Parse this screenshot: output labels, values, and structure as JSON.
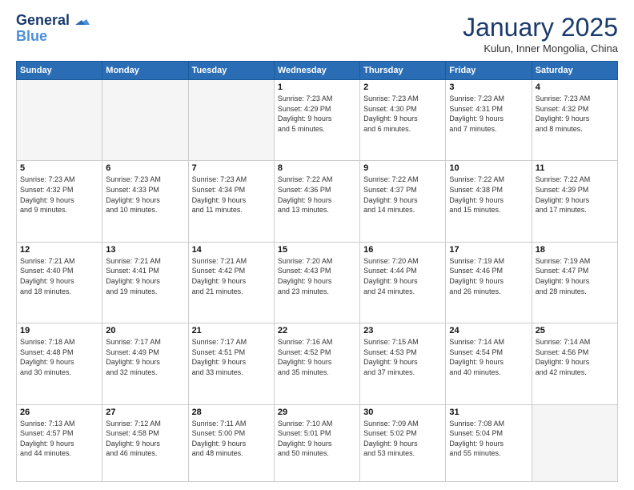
{
  "header": {
    "logo_line1": "General",
    "logo_line2": "Blue",
    "month": "January 2025",
    "location": "Kulun, Inner Mongolia, China"
  },
  "weekdays": [
    "Sunday",
    "Monday",
    "Tuesday",
    "Wednesday",
    "Thursday",
    "Friday",
    "Saturday"
  ],
  "weeks": [
    [
      {
        "day": "",
        "detail": ""
      },
      {
        "day": "",
        "detail": ""
      },
      {
        "day": "",
        "detail": ""
      },
      {
        "day": "1",
        "detail": "Sunrise: 7:23 AM\nSunset: 4:29 PM\nDaylight: 9 hours\nand 5 minutes."
      },
      {
        "day": "2",
        "detail": "Sunrise: 7:23 AM\nSunset: 4:30 PM\nDaylight: 9 hours\nand 6 minutes."
      },
      {
        "day": "3",
        "detail": "Sunrise: 7:23 AM\nSunset: 4:31 PM\nDaylight: 9 hours\nand 7 minutes."
      },
      {
        "day": "4",
        "detail": "Sunrise: 7:23 AM\nSunset: 4:32 PM\nDaylight: 9 hours\nand 8 minutes."
      }
    ],
    [
      {
        "day": "5",
        "detail": "Sunrise: 7:23 AM\nSunset: 4:32 PM\nDaylight: 9 hours\nand 9 minutes."
      },
      {
        "day": "6",
        "detail": "Sunrise: 7:23 AM\nSunset: 4:33 PM\nDaylight: 9 hours\nand 10 minutes."
      },
      {
        "day": "7",
        "detail": "Sunrise: 7:23 AM\nSunset: 4:34 PM\nDaylight: 9 hours\nand 11 minutes."
      },
      {
        "day": "8",
        "detail": "Sunrise: 7:22 AM\nSunset: 4:36 PM\nDaylight: 9 hours\nand 13 minutes."
      },
      {
        "day": "9",
        "detail": "Sunrise: 7:22 AM\nSunset: 4:37 PM\nDaylight: 9 hours\nand 14 minutes."
      },
      {
        "day": "10",
        "detail": "Sunrise: 7:22 AM\nSunset: 4:38 PM\nDaylight: 9 hours\nand 15 minutes."
      },
      {
        "day": "11",
        "detail": "Sunrise: 7:22 AM\nSunset: 4:39 PM\nDaylight: 9 hours\nand 17 minutes."
      }
    ],
    [
      {
        "day": "12",
        "detail": "Sunrise: 7:21 AM\nSunset: 4:40 PM\nDaylight: 9 hours\nand 18 minutes."
      },
      {
        "day": "13",
        "detail": "Sunrise: 7:21 AM\nSunset: 4:41 PM\nDaylight: 9 hours\nand 19 minutes."
      },
      {
        "day": "14",
        "detail": "Sunrise: 7:21 AM\nSunset: 4:42 PM\nDaylight: 9 hours\nand 21 minutes."
      },
      {
        "day": "15",
        "detail": "Sunrise: 7:20 AM\nSunset: 4:43 PM\nDaylight: 9 hours\nand 23 minutes."
      },
      {
        "day": "16",
        "detail": "Sunrise: 7:20 AM\nSunset: 4:44 PM\nDaylight: 9 hours\nand 24 minutes."
      },
      {
        "day": "17",
        "detail": "Sunrise: 7:19 AM\nSunset: 4:46 PM\nDaylight: 9 hours\nand 26 minutes."
      },
      {
        "day": "18",
        "detail": "Sunrise: 7:19 AM\nSunset: 4:47 PM\nDaylight: 9 hours\nand 28 minutes."
      }
    ],
    [
      {
        "day": "19",
        "detail": "Sunrise: 7:18 AM\nSunset: 4:48 PM\nDaylight: 9 hours\nand 30 minutes."
      },
      {
        "day": "20",
        "detail": "Sunrise: 7:17 AM\nSunset: 4:49 PM\nDaylight: 9 hours\nand 32 minutes."
      },
      {
        "day": "21",
        "detail": "Sunrise: 7:17 AM\nSunset: 4:51 PM\nDaylight: 9 hours\nand 33 minutes."
      },
      {
        "day": "22",
        "detail": "Sunrise: 7:16 AM\nSunset: 4:52 PM\nDaylight: 9 hours\nand 35 minutes."
      },
      {
        "day": "23",
        "detail": "Sunrise: 7:15 AM\nSunset: 4:53 PM\nDaylight: 9 hours\nand 37 minutes."
      },
      {
        "day": "24",
        "detail": "Sunrise: 7:14 AM\nSunset: 4:54 PM\nDaylight: 9 hours\nand 40 minutes."
      },
      {
        "day": "25",
        "detail": "Sunrise: 7:14 AM\nSunset: 4:56 PM\nDaylight: 9 hours\nand 42 minutes."
      }
    ],
    [
      {
        "day": "26",
        "detail": "Sunrise: 7:13 AM\nSunset: 4:57 PM\nDaylight: 9 hours\nand 44 minutes."
      },
      {
        "day": "27",
        "detail": "Sunrise: 7:12 AM\nSunset: 4:58 PM\nDaylight: 9 hours\nand 46 minutes."
      },
      {
        "day": "28",
        "detail": "Sunrise: 7:11 AM\nSunset: 5:00 PM\nDaylight: 9 hours\nand 48 minutes."
      },
      {
        "day": "29",
        "detail": "Sunrise: 7:10 AM\nSunset: 5:01 PM\nDaylight: 9 hours\nand 50 minutes."
      },
      {
        "day": "30",
        "detail": "Sunrise: 7:09 AM\nSunset: 5:02 PM\nDaylight: 9 hours\nand 53 minutes."
      },
      {
        "day": "31",
        "detail": "Sunrise: 7:08 AM\nSunset: 5:04 PM\nDaylight: 9 hours\nand 55 minutes."
      },
      {
        "day": "",
        "detail": ""
      }
    ]
  ]
}
